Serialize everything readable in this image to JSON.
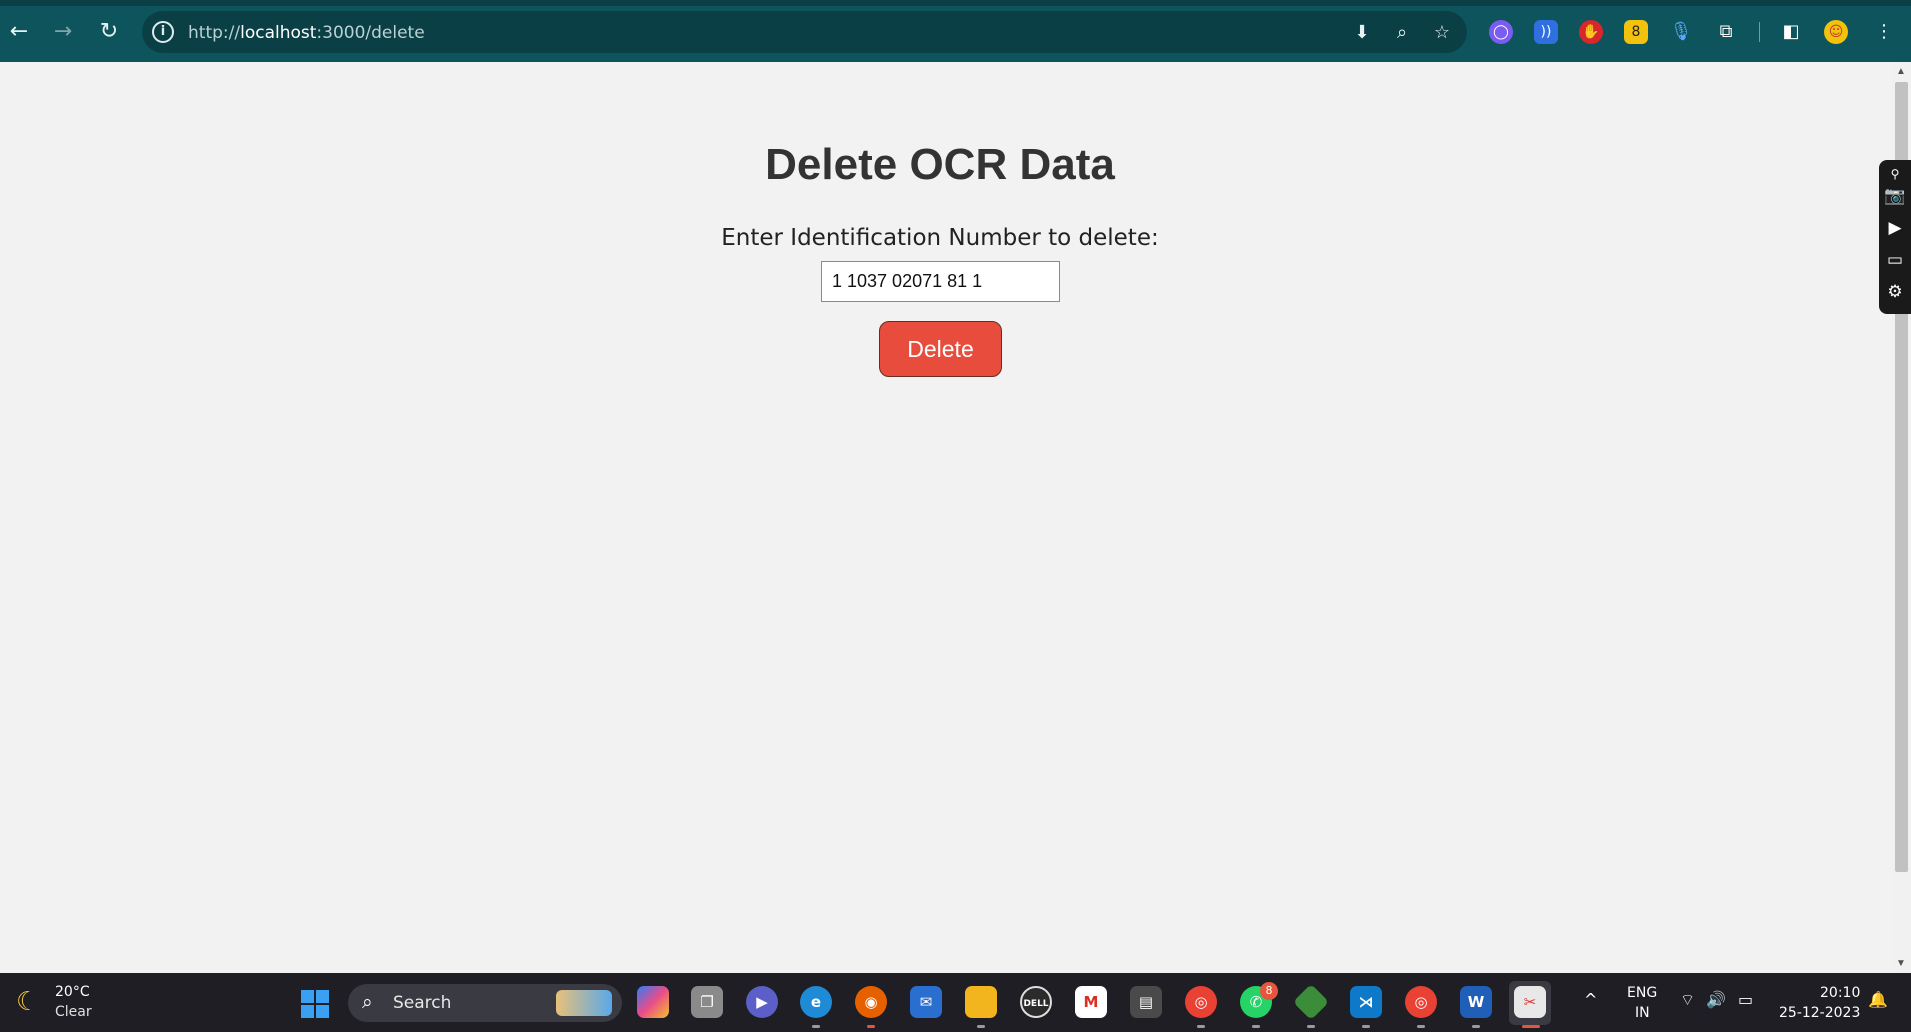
{
  "browser": {
    "url_prefix": "http://",
    "url_host": "localhost",
    "url_rest": ":3000/delete"
  },
  "page": {
    "title": "Delete OCR Data",
    "label": "Enter Identification Number to delete:",
    "id_value": "1 1037 02071 81 1",
    "delete_label": "Delete"
  },
  "taskbar": {
    "temperature": "20°C",
    "condition": "Clear",
    "search_label": "Search",
    "whatsapp_badge": "8",
    "lang_top": "ENG",
    "lang_bottom": "IN",
    "time": "20:10",
    "date": "25-12-2023"
  },
  "colors": {
    "chrome": "#0e545c",
    "delete_button": "#e74c3c",
    "taskbar": "#1e1e24"
  }
}
